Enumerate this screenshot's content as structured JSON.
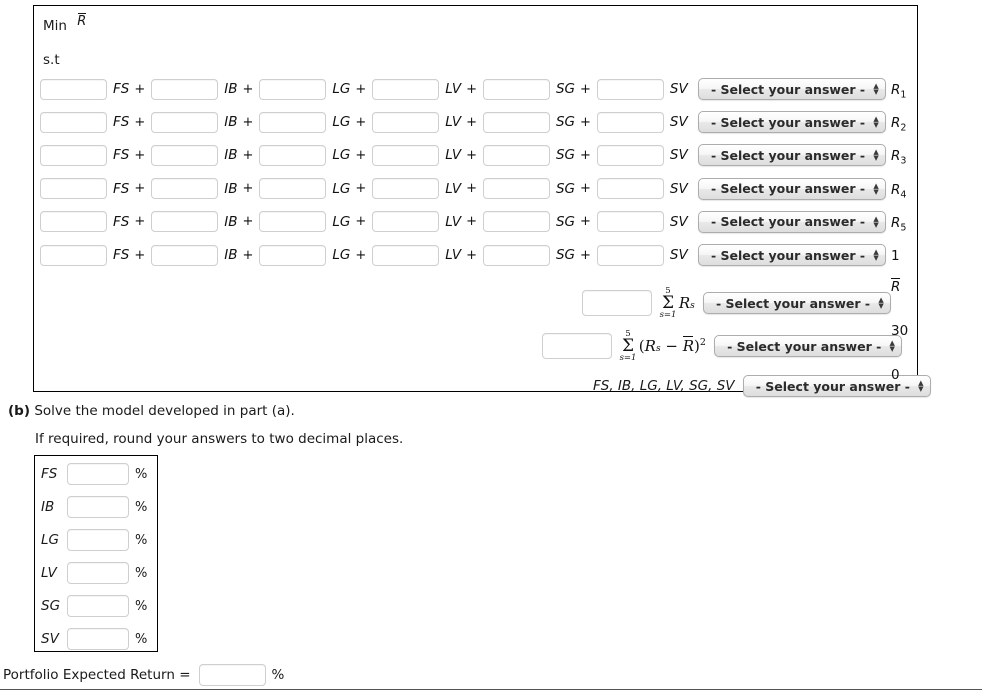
{
  "model": {
    "objective_prefix": "Min",
    "objective_var": "R̄",
    "subject_to": "s.t",
    "select_placeholder": "- Select your answer -",
    "plus": "+",
    "variables": [
      "FS",
      "IB",
      "LG",
      "LV",
      "SG",
      "SV"
    ],
    "constraint_rows": [
      {
        "rhs": "R",
        "rhs_sub": "1",
        "rhs_italic": true
      },
      {
        "rhs": "R",
        "rhs_sub": "2",
        "rhs_italic": true
      },
      {
        "rhs": "R",
        "rhs_sub": "3",
        "rhs_italic": true
      },
      {
        "rhs": "R",
        "rhs_sub": "4",
        "rhs_italic": true
      },
      {
        "rhs": "R",
        "rhs_sub": "5",
        "rhs_italic": true
      },
      {
        "rhs": "1",
        "rhs_sub": "",
        "rhs_italic": false
      }
    ],
    "summation_rows": [
      {
        "formula_text": "Σ(s=1..5) R_s",
        "sigma": "Σ",
        "limit_top": "5",
        "limit_bottom": "s=1",
        "body": "R",
        "body_sub": "s",
        "rhs": "R̄",
        "rhs_italic": true
      },
      {
        "formula_text": "Σ(s=1..5) (R_s − R̄)²",
        "sigma": "Σ",
        "limit_top": "5",
        "limit_bottom": "s=1",
        "open_paren": "(",
        "body": "R",
        "body_sub": "s",
        "minus": "−",
        "mean": "R̄",
        "close_paren": ")",
        "power": "2",
        "rhs": "30",
        "rhs_italic": false
      }
    ],
    "nonnegativity_row": {
      "variable_list": "FS, IB, LG, LV, SG, SV",
      "rhs": "0"
    }
  },
  "part_b": {
    "label_marker": "(b)",
    "label_text": "Solve the model developed in part (a).",
    "note": "If required, round your answers to two decimal places.",
    "percent_symbol": "%",
    "rows": [
      {
        "label": "FS",
        "value": ""
      },
      {
        "label": "IB",
        "value": ""
      },
      {
        "label": "LG",
        "value": ""
      },
      {
        "label": "LV",
        "value": ""
      },
      {
        "label": "SG",
        "value": ""
      },
      {
        "label": "SV",
        "value": ""
      }
    ],
    "portfolio_return_label": "Portfolio Expected Return =",
    "portfolio_return_value": "",
    "portfolio_percent": "%"
  },
  "colors": {
    "page_background": "#ffffff",
    "box_border": "#000000",
    "input_border": "#cfcfcf",
    "select_border": "#adadad",
    "text": "#1a1a1a"
  }
}
